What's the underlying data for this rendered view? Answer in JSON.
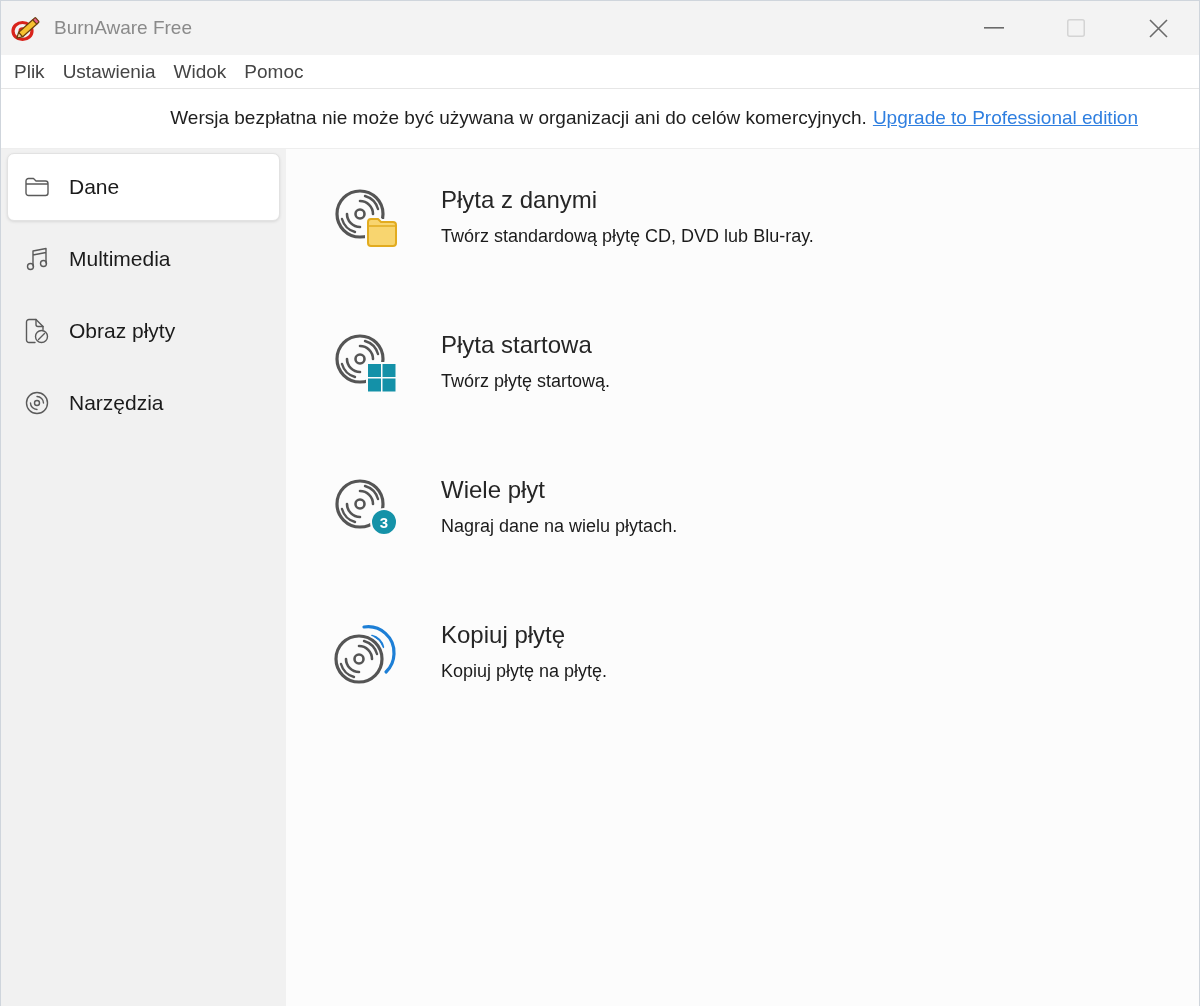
{
  "window": {
    "title": "BurnAware Free",
    "maximize_disabled": true
  },
  "menu": [
    {
      "label": "Plik"
    },
    {
      "label": "Ustawienia"
    },
    {
      "label": "Widok"
    },
    {
      "label": "Pomoc"
    }
  ],
  "notice": {
    "text": "Wersja bezpłatna nie może być używana w organizacji ani do celów komercyjnych.",
    "link": "Upgrade to Professional edition"
  },
  "sidebar": {
    "items": [
      {
        "label": "Dane",
        "selected": true
      },
      {
        "label": "Multimedia",
        "selected": false
      },
      {
        "label": "Obraz płyty",
        "selected": false
      },
      {
        "label": "Narzędzia",
        "selected": false
      }
    ]
  },
  "tasks": [
    {
      "title": "Płyta z danymi",
      "description": "Twórz standardową płytę CD, DVD lub Blu-ray."
    },
    {
      "title": "Płyta startowa",
      "description": "Twórz płytę startową."
    },
    {
      "title": "Wiele płyt",
      "description": "Nagraj dane na wielu płytach.",
      "badge": "3"
    },
    {
      "title": "Kopiuj płytę",
      "description": "Kopiuj płytę na płytę."
    }
  ]
}
